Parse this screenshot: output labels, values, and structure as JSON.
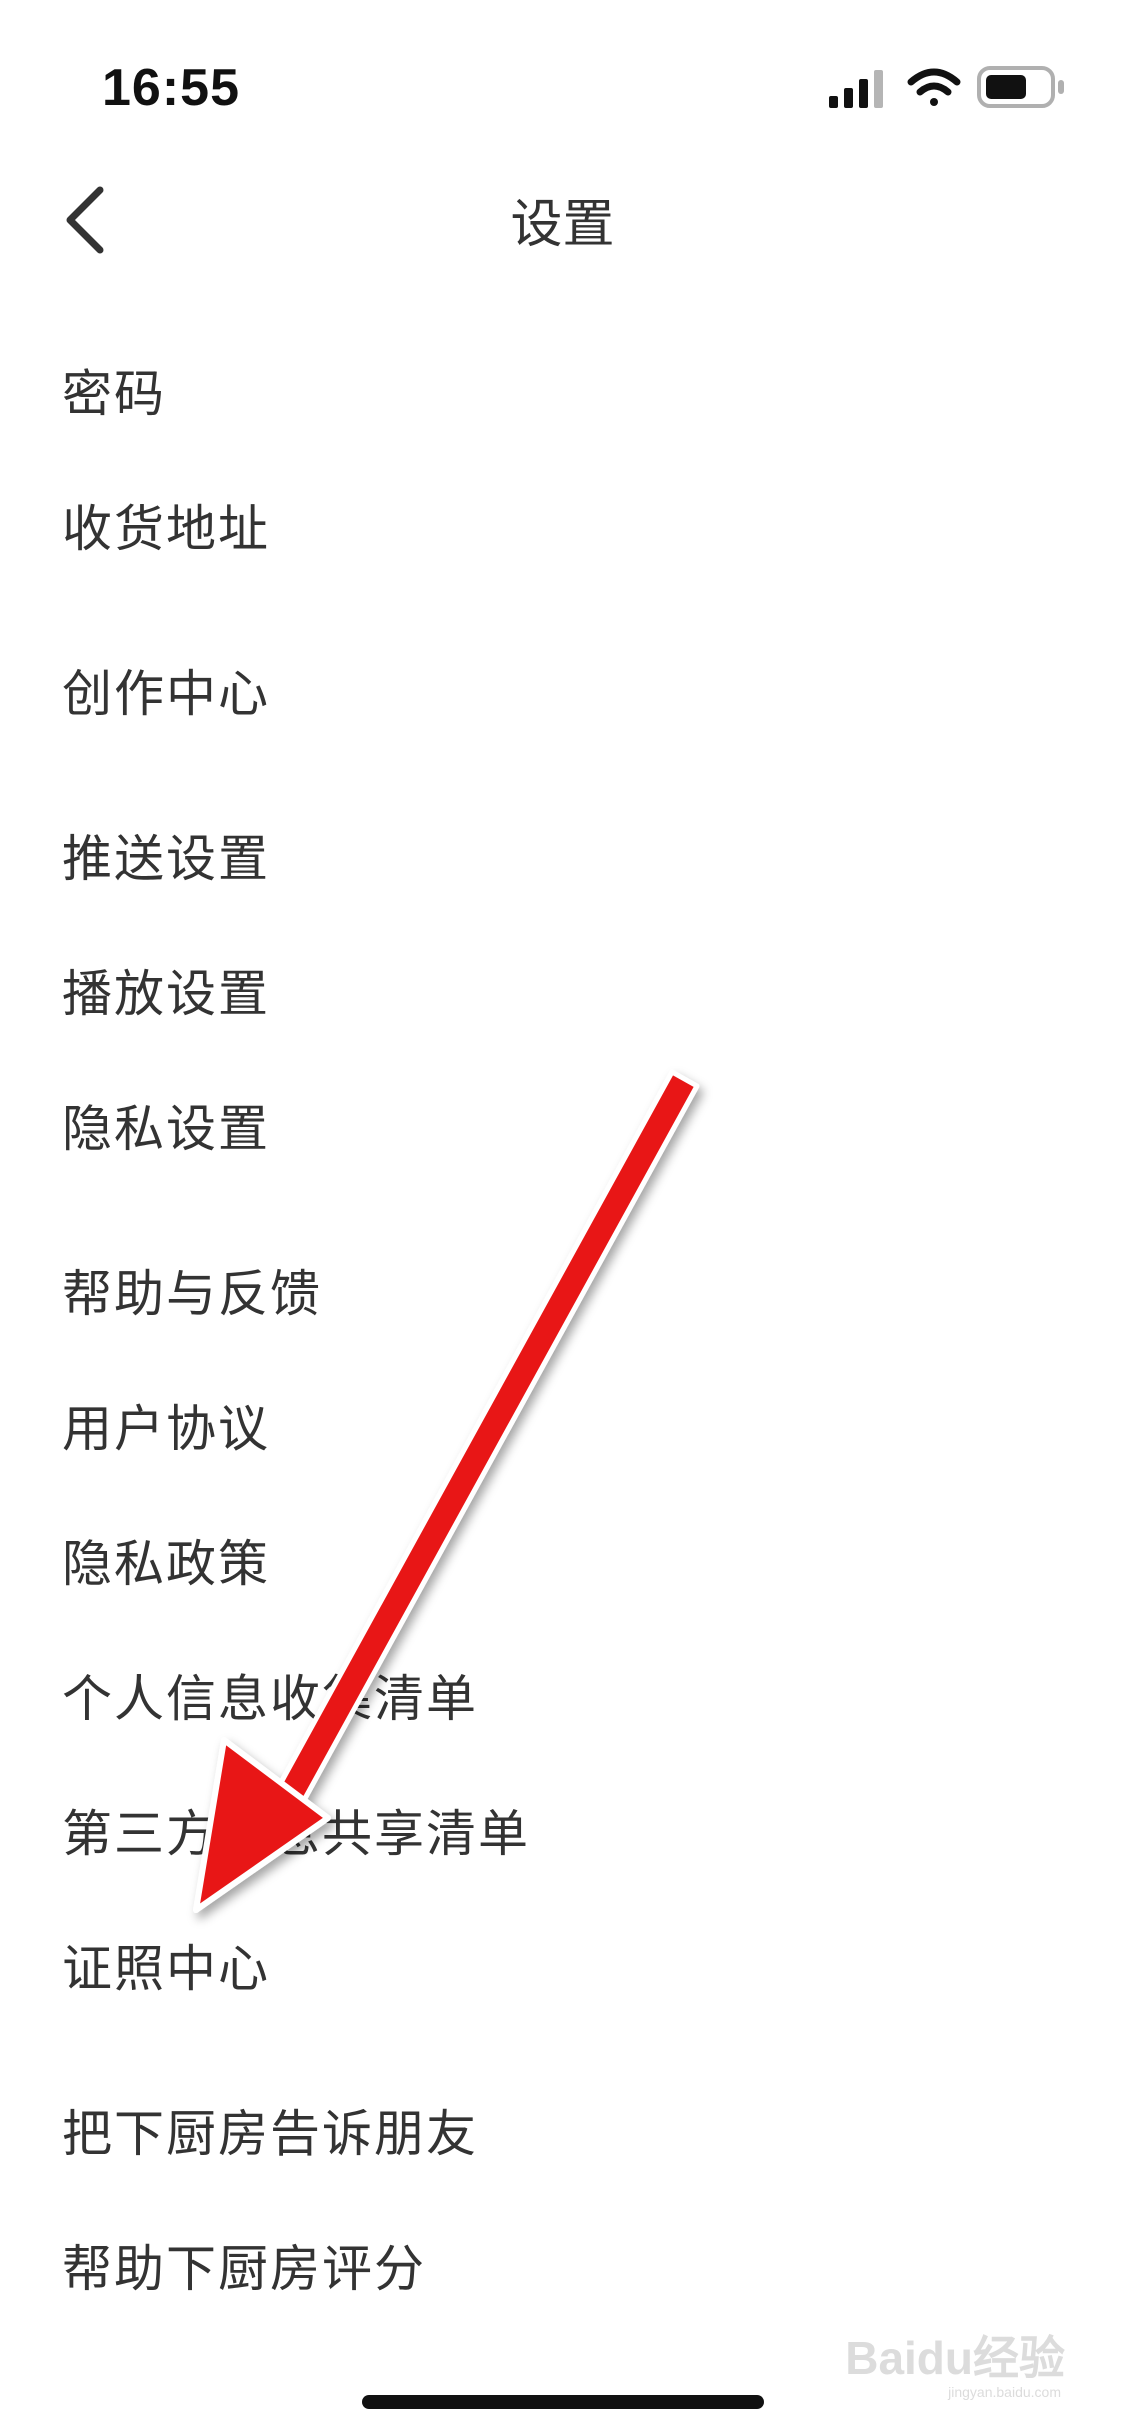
{
  "status_bar": {
    "time": "16:55",
    "icons": [
      "cellular-signal-icon",
      "wifi-icon",
      "battery-icon"
    ]
  },
  "nav": {
    "back_icon": "chevron-left-icon",
    "title": "设置"
  },
  "menu": {
    "items": [
      {
        "label": "密码"
      },
      {
        "label": "收货地址"
      },
      {
        "label": "创作中心"
      },
      {
        "label": "推送设置"
      },
      {
        "label": "播放设置"
      },
      {
        "label": "隐私设置"
      },
      {
        "label": "帮助与反馈"
      },
      {
        "label": "用户协议"
      },
      {
        "label": "隐私政策"
      },
      {
        "label": "个人信息收集清单"
      },
      {
        "label": "第三方信息共享清单"
      },
      {
        "label": "证照中心"
      },
      {
        "label": "把下厨房告诉朋友"
      },
      {
        "label": "帮助下厨房评分"
      }
    ]
  },
  "annotation": {
    "type": "red-arrow-icon",
    "color": "#e81818"
  },
  "watermark": {
    "logo": "Baidu经验",
    "sub": "jingyan.baidu.com"
  }
}
